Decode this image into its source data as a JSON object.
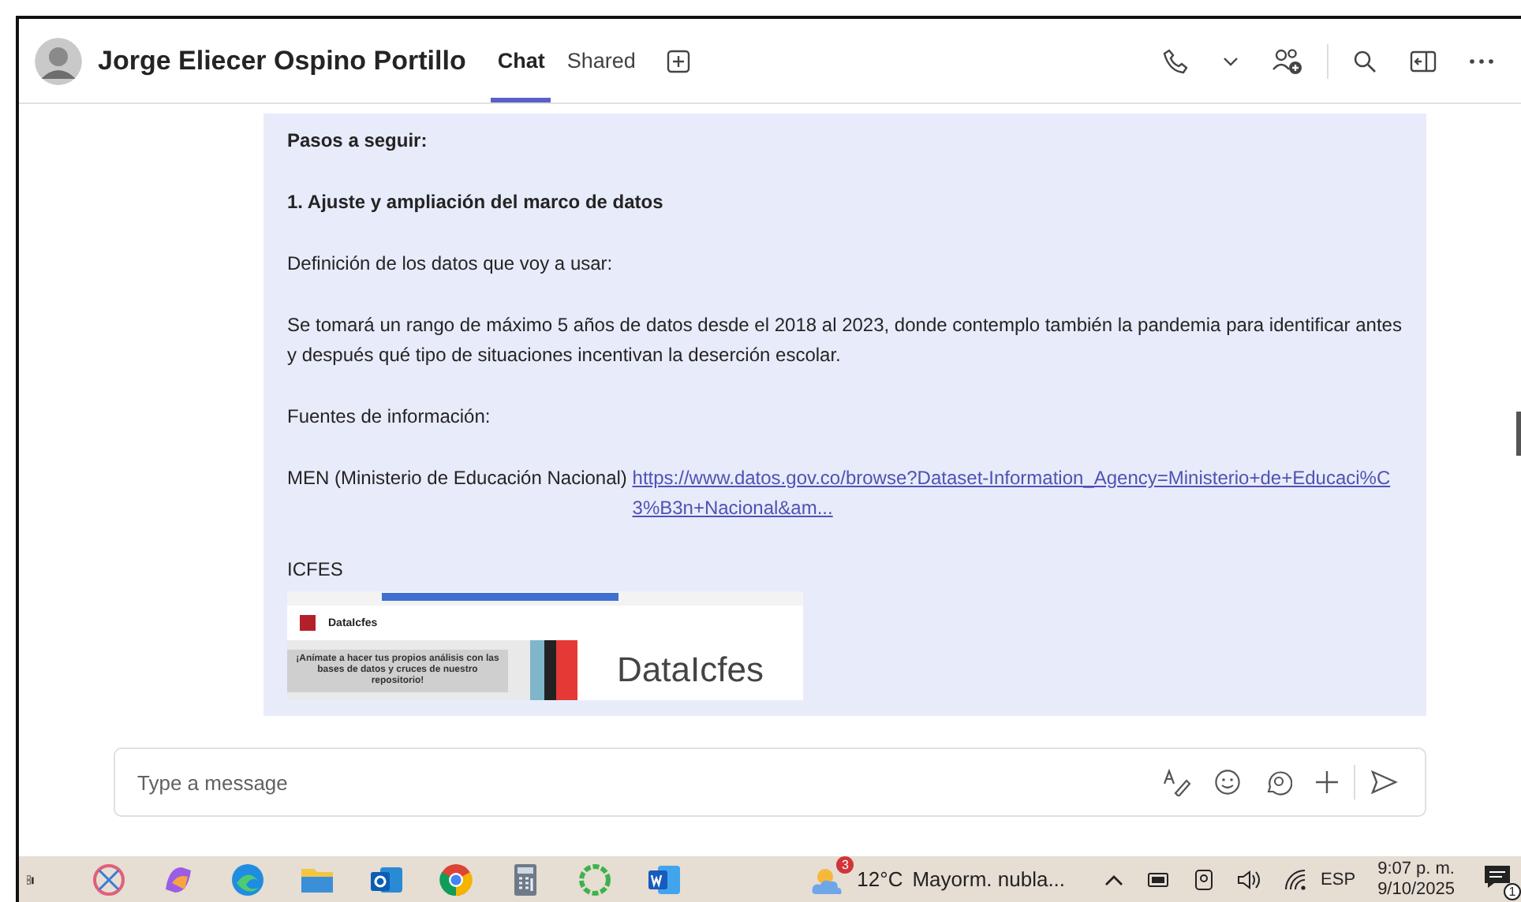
{
  "header": {
    "contact_name": "Jorge Eliecer Ospino Portillo",
    "tabs": [
      {
        "label": "Chat",
        "selected": true
      },
      {
        "label": "Shared",
        "selected": false
      }
    ]
  },
  "message": {
    "paragraphs": [
      {
        "kind": "bold",
        "text": "Pasos a seguir:"
      },
      {
        "kind": "bold",
        "text": "1. Ajuste y ampliación del marco de datos"
      },
      {
        "kind": "plain",
        "text": "Definición de los datos que voy a usar:"
      },
      {
        "kind": "plain",
        "text": "Se tomará un rango de máximo 5 años de datos desde el 2018 al 2023, donde contemplo también la pandemia para identificar antes y después qué tipo de situaciones incentivan la deserción escolar."
      },
      {
        "kind": "plain",
        "text": "Fuentes de información:"
      },
      {
        "kind": "link",
        "text": "MEN (Ministerio de Educación Nacional) ",
        "link": "https://www.datos.gov.co/browse?Dataset-Information_Agency=Ministerio+de+Educaci%C3%B3n+Nacional&am..."
      },
      {
        "kind": "plain",
        "text": "ICFES"
      }
    ],
    "embedded_screenshot": {
      "site_name": "DataIcfes",
      "banner_text": "¡Anímate a hacer tus propios análisis con las bases de datos y cruces de nuestro repositorio!",
      "logo_text": "DataIcfes"
    }
  },
  "composer": {
    "placeholder": "Type a message"
  },
  "taskbar": {
    "weather": {
      "badge": "3",
      "temperature": "12°C",
      "condition": "Mayorm. nubla..."
    },
    "language": "ESP",
    "time": "9:07 p. m.",
    "date": "9/10/2025",
    "notification_count": "1"
  }
}
